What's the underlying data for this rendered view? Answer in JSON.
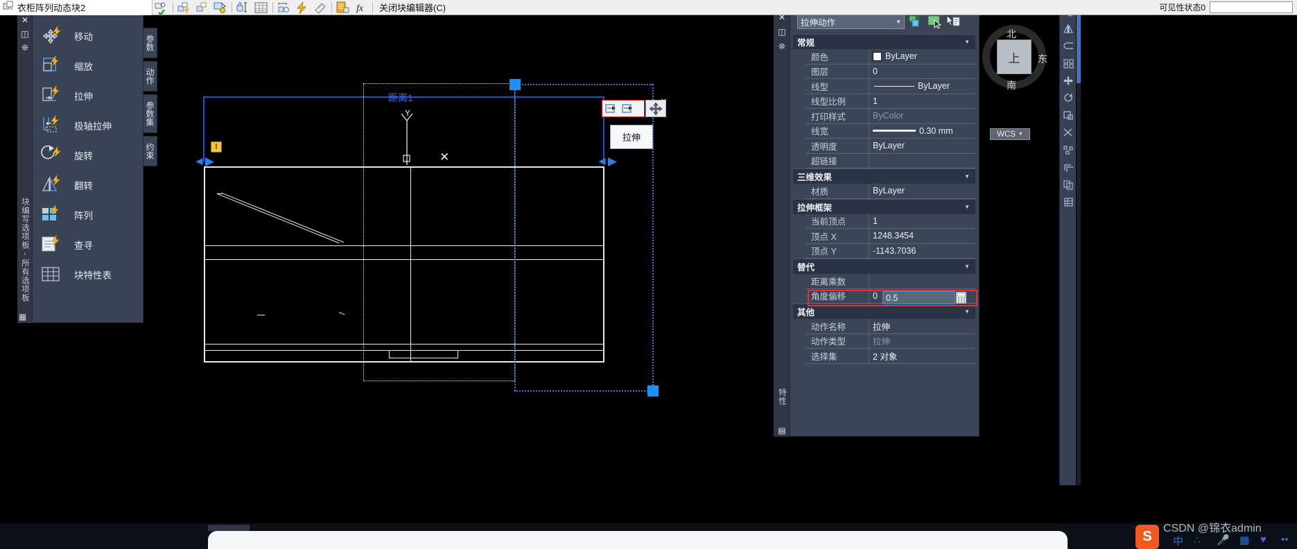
{
  "window": {
    "block_title": "衣柜阵列动态块2",
    "close_editor_label": "关闭块编辑器(C)",
    "visibility_label": "可见性状态0",
    "visibility_value": ""
  },
  "toolbar": {
    "icons": [
      {
        "name": "test-block-icon",
        "glyph": "test-block"
      },
      {
        "name": "parameter-icon",
        "glyph": "param"
      },
      {
        "name": "parameter-set-icon",
        "glyph": "paramset"
      },
      {
        "name": "attribute-define-icon",
        "glyph": "attrib"
      },
      {
        "name": "constraint-icon",
        "glyph": "constraint"
      },
      {
        "name": "block-table-icon",
        "glyph": "table"
      },
      {
        "name": "parameter-manager-icon",
        "glyph": "parammgr"
      },
      {
        "name": "action-bolt-icon",
        "glyph": "bolt"
      },
      {
        "name": "visibility-icon",
        "glyph": "visibility"
      },
      {
        "name": "block-properties-icon",
        "glyph": "blockprops"
      },
      {
        "name": "function-icon",
        "glyph": "fx"
      }
    ]
  },
  "palette": {
    "vertical_title": "块编写选项板 - 所有选项板",
    "gutter_icons": [
      "close-icon",
      "auto-hide-icon",
      "properties-menu-icon"
    ],
    "items": [
      {
        "label": "移动",
        "icon": "move-action-icon"
      },
      {
        "label": "缩放",
        "icon": "scale-action-icon"
      },
      {
        "label": "拉伸",
        "icon": "stretch-action-icon"
      },
      {
        "label": "极轴拉伸",
        "icon": "polar-stretch-action-icon"
      },
      {
        "label": "旋转",
        "icon": "rotate-action-icon"
      },
      {
        "label": "翻转",
        "icon": "flip-action-icon"
      },
      {
        "label": "阵列",
        "icon": "array-action-icon"
      },
      {
        "label": "查寻",
        "icon": "lookup-action-icon"
      },
      {
        "label": "块特性表",
        "icon": "block-properties-table-icon"
      }
    ],
    "tabs": [
      "参数",
      "动作",
      "参数集",
      "约束"
    ]
  },
  "properties": {
    "vertical_title": "特性",
    "gutter_icons": [
      "close-icon",
      "auto-hide-icon",
      "properties-menu-icon"
    ],
    "selector_value": "拉伸动作",
    "header_buttons": [
      "quick-select-icon",
      "select-objects-icon",
      "pick-point-icon"
    ],
    "sections": [
      {
        "title": "常规",
        "rows": [
          {
            "key": "颜色",
            "value": "ByLayer",
            "kind": "color"
          },
          {
            "key": "图层",
            "value": "0",
            "kind": "text"
          },
          {
            "key": "线型",
            "value": "ByLayer",
            "kind": "linetype"
          },
          {
            "key": "线型比例",
            "value": "1",
            "kind": "text"
          },
          {
            "key": "打印样式",
            "value": "ByColor",
            "kind": "dim"
          },
          {
            "key": "线宽",
            "value": "0.30 mm",
            "kind": "lineweight"
          },
          {
            "key": "透明度",
            "value": "ByLayer",
            "kind": "text"
          },
          {
            "key": "超链接",
            "value": "",
            "kind": "text"
          }
        ]
      },
      {
        "title": "三维效果",
        "rows": [
          {
            "key": "材质",
            "value": "ByLayer",
            "kind": "text"
          }
        ]
      },
      {
        "title": "拉伸框架",
        "rows": [
          {
            "key": "当前顶点",
            "value": "1",
            "kind": "text"
          },
          {
            "key": "顶点 X",
            "value": "1248.3454",
            "kind": "text"
          },
          {
            "key": "顶点 Y",
            "value": "-1143.7036",
            "kind": "text"
          }
        ]
      },
      {
        "title": "替代",
        "rows": [
          {
            "key": "距离乘数",
            "value": "0.5",
            "kind": "editing"
          },
          {
            "key": "角度偏移",
            "value": "0",
            "kind": "text"
          }
        ]
      },
      {
        "title": "其他",
        "rows": [
          {
            "key": "动作名称",
            "value": "拉伸",
            "kind": "text"
          },
          {
            "key": "动作类型",
            "value": "拉伸",
            "kind": "dim"
          },
          {
            "key": "选择集",
            "value": "2 对象",
            "kind": "text"
          }
        ]
      }
    ],
    "highlight_color": "#ef2d2d",
    "edit_value": "0.5",
    "calculator_icon": "calculator-icon"
  },
  "canvas": {
    "dimension_label": "距离1",
    "ucs_x_label": "",
    "ucs_y_label": "Y",
    "warning_icon": "warning-icon",
    "grip_toolbar_icons": [
      "stretch-grip-icon",
      "stretch-grip-alt-icon",
      "move-grip-icon"
    ],
    "tooltip_text": "拉伸",
    "grip_color": "#1f8ff5",
    "frame_color": "#2b7fe8"
  },
  "viewcube": {
    "top_label": "上",
    "north": "北",
    "east": "东",
    "south": "南",
    "ucs_label": "WCS"
  },
  "navbar": {
    "icons": [
      "block-icon",
      "mirror-icon",
      "fillet-icon",
      "array-icon",
      "move-icon",
      "rotate-icon",
      "scale-icon",
      "trim-icon",
      "explode-icon",
      "offset-icon",
      "copy-icon",
      "properties-icon"
    ]
  },
  "footer": {
    "watermark": "CSDN @锦衣admin",
    "ime_icon": "sogou-icon",
    "taskbar_icons": [
      "ime-cn-icon",
      "voice-icon",
      "mic-icon",
      "keyboard-icon",
      "heart-icon",
      "more-icon"
    ]
  }
}
